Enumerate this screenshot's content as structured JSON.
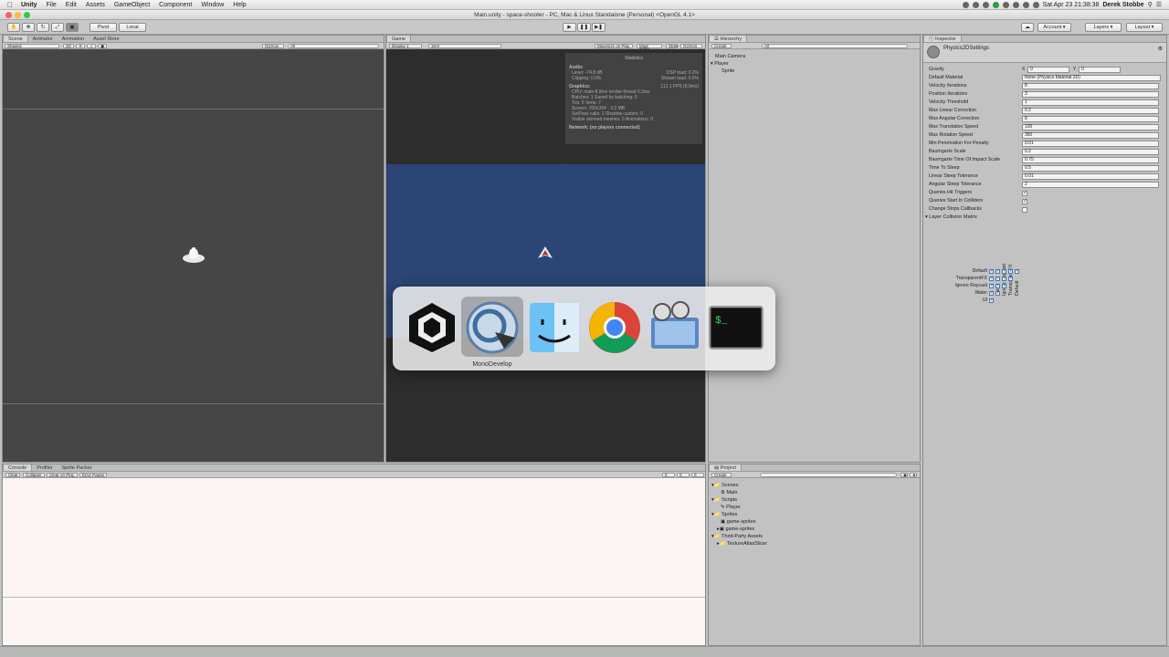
{
  "menubar": {
    "items": [
      "Unity",
      "File",
      "Edit",
      "Assets",
      "GameObject",
      "Component",
      "Window",
      "Help"
    ],
    "clock": "Sat Apr 23  21:38:38",
    "user": "Derek Stobbe"
  },
  "window": {
    "title": "Main.unity - space-shooter - PC, Mac & Linux Standalone (Personal) <OpenGL 4.1>"
  },
  "toolbar": {
    "pivot": "Pivot",
    "local": "Local",
    "account": "Account",
    "layers": "Layers",
    "layout": "Layout"
  },
  "scene": {
    "tabs": [
      "Scene",
      "Animator",
      "Animation",
      "Asset Store"
    ],
    "shading": "Shaded",
    "mode2d": "2D",
    "gizmos": "Gizmos",
    "search": "All"
  },
  "game": {
    "tab": "Game",
    "display": "Display 1",
    "aspect": "16:9",
    "options": [
      "Maximize on Play",
      "Mute audio",
      "Stats",
      "Gizmos"
    ],
    "stats": {
      "title": "Statistics",
      "audio_label": "Audio:",
      "level": "Level: -74.8 dB",
      "clipping": "Clipping: 0.0%",
      "dsp": "DSP load: 0.2%",
      "stream": "Stream load: 0.0%",
      "graphics_label": "Graphics:",
      "fps": "112.1 FPS (8.9ms)",
      "cpu": "CPU: main 8.9ms  render thread 0.3ms",
      "batches": "Batches: 1     Saved by batching: 0",
      "tris": "Tris: 5   Verts: 7",
      "screen": "Screen: 700x394 - 3.2 MB",
      "setpass": "SetPass calls: 1   Shadow casters: 0",
      "visible": "Visible skinned meshes: 0  Animations: 0",
      "network": "Network: (no players connected)"
    }
  },
  "hierarchy": {
    "tab": "Hierarchy",
    "create": "Create",
    "search": "All",
    "items": [
      "Main Camera",
      "Player",
      "Sprite"
    ]
  },
  "inspector": {
    "tab": "Inspector",
    "title": "Physics2DSettings",
    "gravity_label": "Gravity",
    "gravity_x": "0",
    "gravity_y": "0",
    "rows": [
      {
        "label": "Default Material",
        "value": "None (Physics Material 2D)"
      },
      {
        "label": "Velocity Iterations",
        "value": "8"
      },
      {
        "label": "Position Iterations",
        "value": "3"
      },
      {
        "label": "Velocity Threshold",
        "value": "1"
      },
      {
        "label": "Max Linear Correction",
        "value": "0.2"
      },
      {
        "label": "Max Angular Correction",
        "value": "8"
      },
      {
        "label": "Max Translation Speed",
        "value": "100"
      },
      {
        "label": "Max Rotation Speed",
        "value": "360"
      },
      {
        "label": "Min Penetration For Penalty",
        "value": "0.01"
      },
      {
        "label": "Baumgarte Scale",
        "value": "0.2"
      },
      {
        "label": "Baumgarte Time Of Impact Scale",
        "value": "0.75"
      },
      {
        "label": "Time To Sleep",
        "value": "0.5"
      },
      {
        "label": "Linear Sleep Tolerance",
        "value": "0.01"
      },
      {
        "label": "Angular Sleep Tolerance",
        "value": "2"
      }
    ],
    "checks": [
      {
        "label": "Queries Hit Triggers",
        "checked": true
      },
      {
        "label": "Queries Start In Colliders",
        "checked": true
      },
      {
        "label": "Change Stops Callbacks",
        "checked": false
      }
    ],
    "matrix_title": "Layer Collision Matrix",
    "matrix_layers": [
      "Default",
      "TransparentFX",
      "Ignore Raycast",
      "Water",
      "UI"
    ]
  },
  "console": {
    "tabs": [
      "Console",
      "Profiler",
      "Sprite Packer"
    ],
    "buttons": [
      "Clear",
      "Collapse",
      "Clear on Play",
      "Error Pause"
    ],
    "counts": [
      "0",
      "0",
      "0"
    ]
  },
  "project": {
    "tab": "Project",
    "create": "Create",
    "tree": [
      {
        "label": "Scenes",
        "indent": 0
      },
      {
        "label": "Main",
        "indent": 1
      },
      {
        "label": "Scripts",
        "indent": 0
      },
      {
        "label": "Player",
        "indent": 1
      },
      {
        "label": "Sprites",
        "indent": 0
      },
      {
        "label": "game-sprites",
        "indent": 1
      },
      {
        "label": "game-sprites",
        "indent": 1
      },
      {
        "label": "Third-Party Assets",
        "indent": 0
      },
      {
        "label": "TextureAtlasSlicer",
        "indent": 1
      }
    ]
  },
  "switcher": {
    "apps": [
      "unity-icon",
      "monodevelop-icon",
      "finder-icon",
      "chrome-icon",
      "video-icon",
      "terminal-icon"
    ],
    "selected_label": "MonoDevelop"
  }
}
